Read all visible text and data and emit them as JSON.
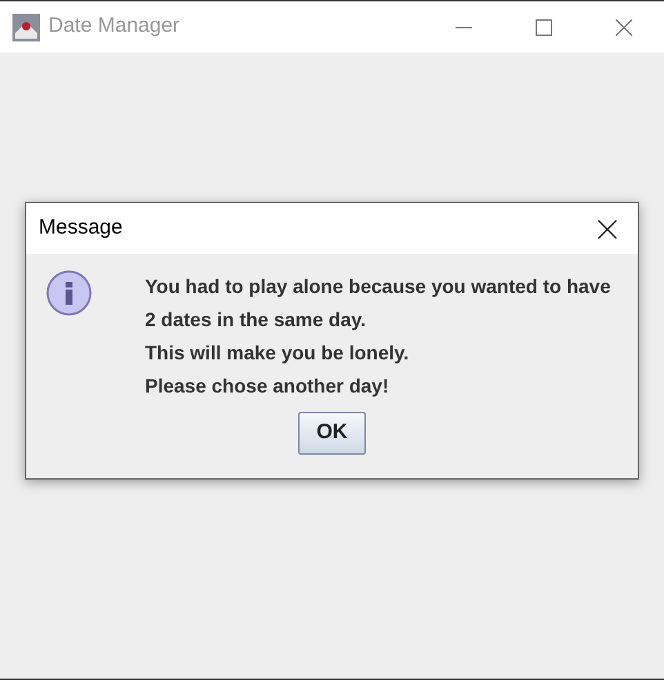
{
  "window": {
    "title": "Date Manager"
  },
  "dialog": {
    "title": "Message",
    "lines": [
      "You had to play alone because you wanted to have",
      "2 dates in the same day.",
      "This will make you be lonely.",
      "Please chose another day!"
    ],
    "button": "OK"
  }
}
